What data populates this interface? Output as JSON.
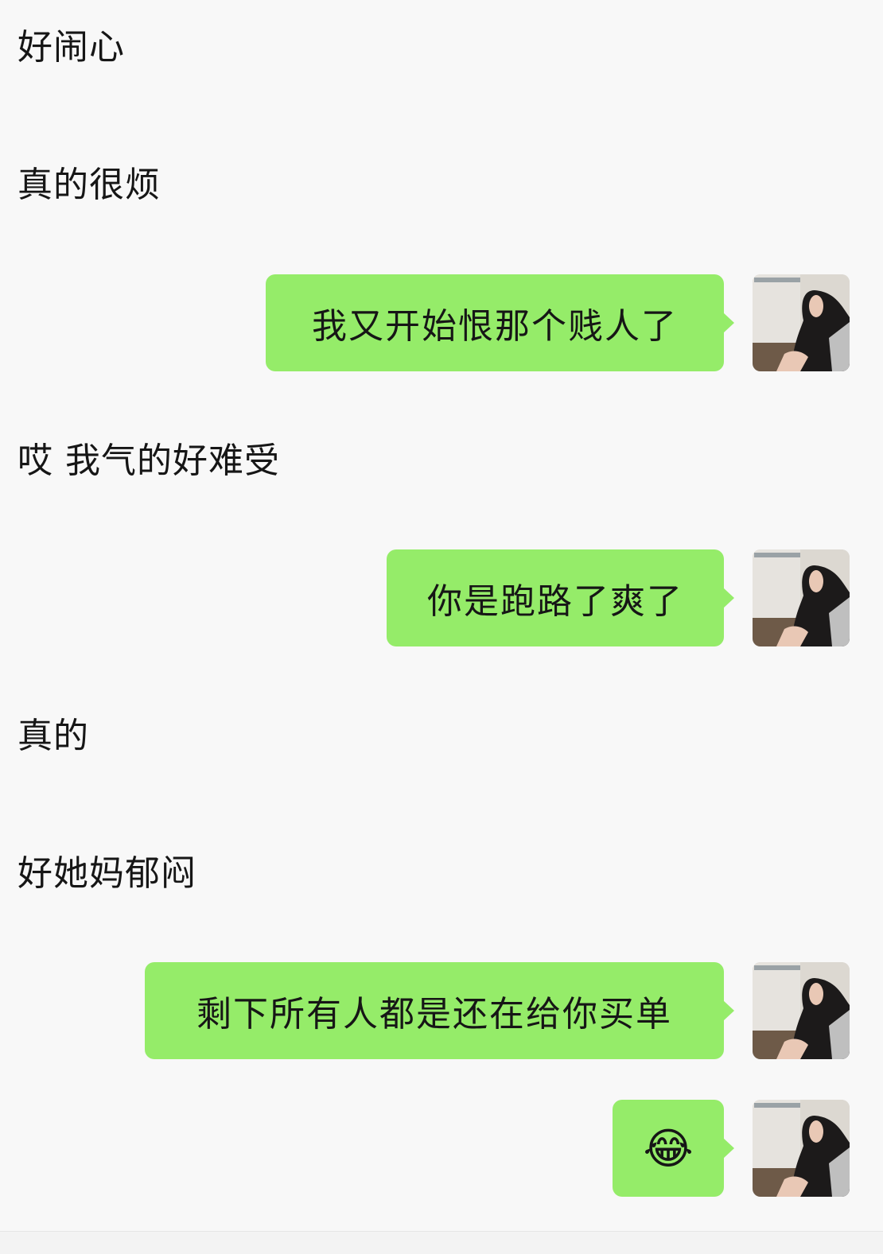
{
  "messages": [
    {
      "side": "received",
      "text": "好闹心"
    },
    {
      "side": "received",
      "text": "真的很烦"
    },
    {
      "side": "sent",
      "text": "我又开始恨那个贱人了"
    },
    {
      "side": "received",
      "text": "哎 我气的好难受"
    },
    {
      "side": "sent",
      "text": "你是跑路了爽了"
    },
    {
      "side": "received",
      "text": "真的"
    },
    {
      "side": "received",
      "text": "好她妈郁闷"
    },
    {
      "side": "sent",
      "text": "剩下所有人都是还在给你买单"
    },
    {
      "side": "sent",
      "text": "😂",
      "kind": "emoji",
      "icon": "face-with-tears-of-joy-icon"
    }
  ],
  "colors": {
    "background": "#f8f8f8",
    "sent_bubble": "#95ec69",
    "text": "#161616"
  }
}
